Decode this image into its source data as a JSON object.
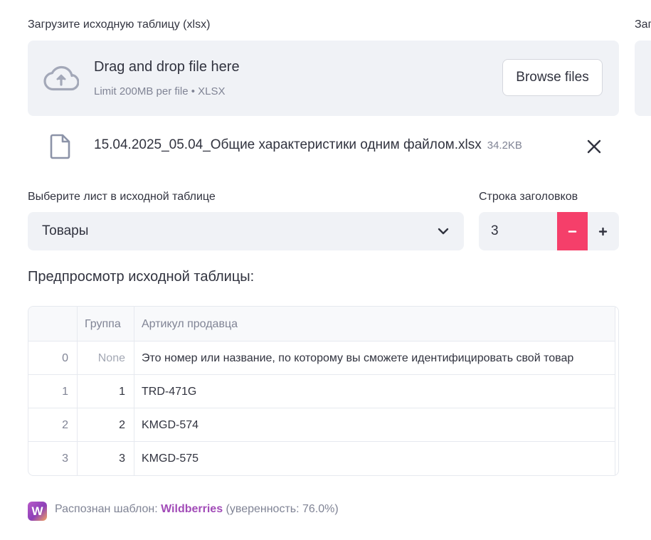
{
  "uploader": {
    "label": "Загрузите исходную таблицу (xlsx)",
    "dropzone_title": "Drag and drop file here",
    "dropzone_subtitle": "Limit 200MB per file • XLSX",
    "browse_label": "Browse files",
    "icon": "cloud-upload-icon"
  },
  "right_column": {
    "label": "Заг"
  },
  "uploaded_file": {
    "name": "15.04.2025_05.04_Общие характеристики одним файлом.xlsx",
    "size": "34.2KB",
    "icon": "file-icon",
    "remove_icon": "close-icon"
  },
  "sheet_select": {
    "label": "Выберите лист в исходной таблице",
    "value": "Товары"
  },
  "header_row": {
    "label": "Строка заголовков",
    "value": "3",
    "minus": "−",
    "plus": "+"
  },
  "preview": {
    "title": "Предпросмотр исходной таблицы:",
    "columns": [
      "",
      "Группа",
      "Артикул продавца"
    ],
    "rows": [
      {
        "index": "0",
        "group": "None",
        "article": "Это номер или название, по которому вы сможете идентифицировать свой товар"
      },
      {
        "index": "1",
        "group": "1",
        "article": "TRD-471G"
      },
      {
        "index": "2",
        "group": "2",
        "article": "KMGD-574"
      },
      {
        "index": "3",
        "group": "3",
        "article": "KMGD-575"
      }
    ]
  },
  "detection": {
    "logo_letter": "W",
    "prefix": "Распознан шаблон: ",
    "template": "Wildberries",
    "confidence": " (уверенность: 76.0%)"
  },
  "colors": {
    "accent": "#f53f6a",
    "surface": "#f0f2f6",
    "muted_text": "#808495",
    "brand": "#a24cb8"
  }
}
